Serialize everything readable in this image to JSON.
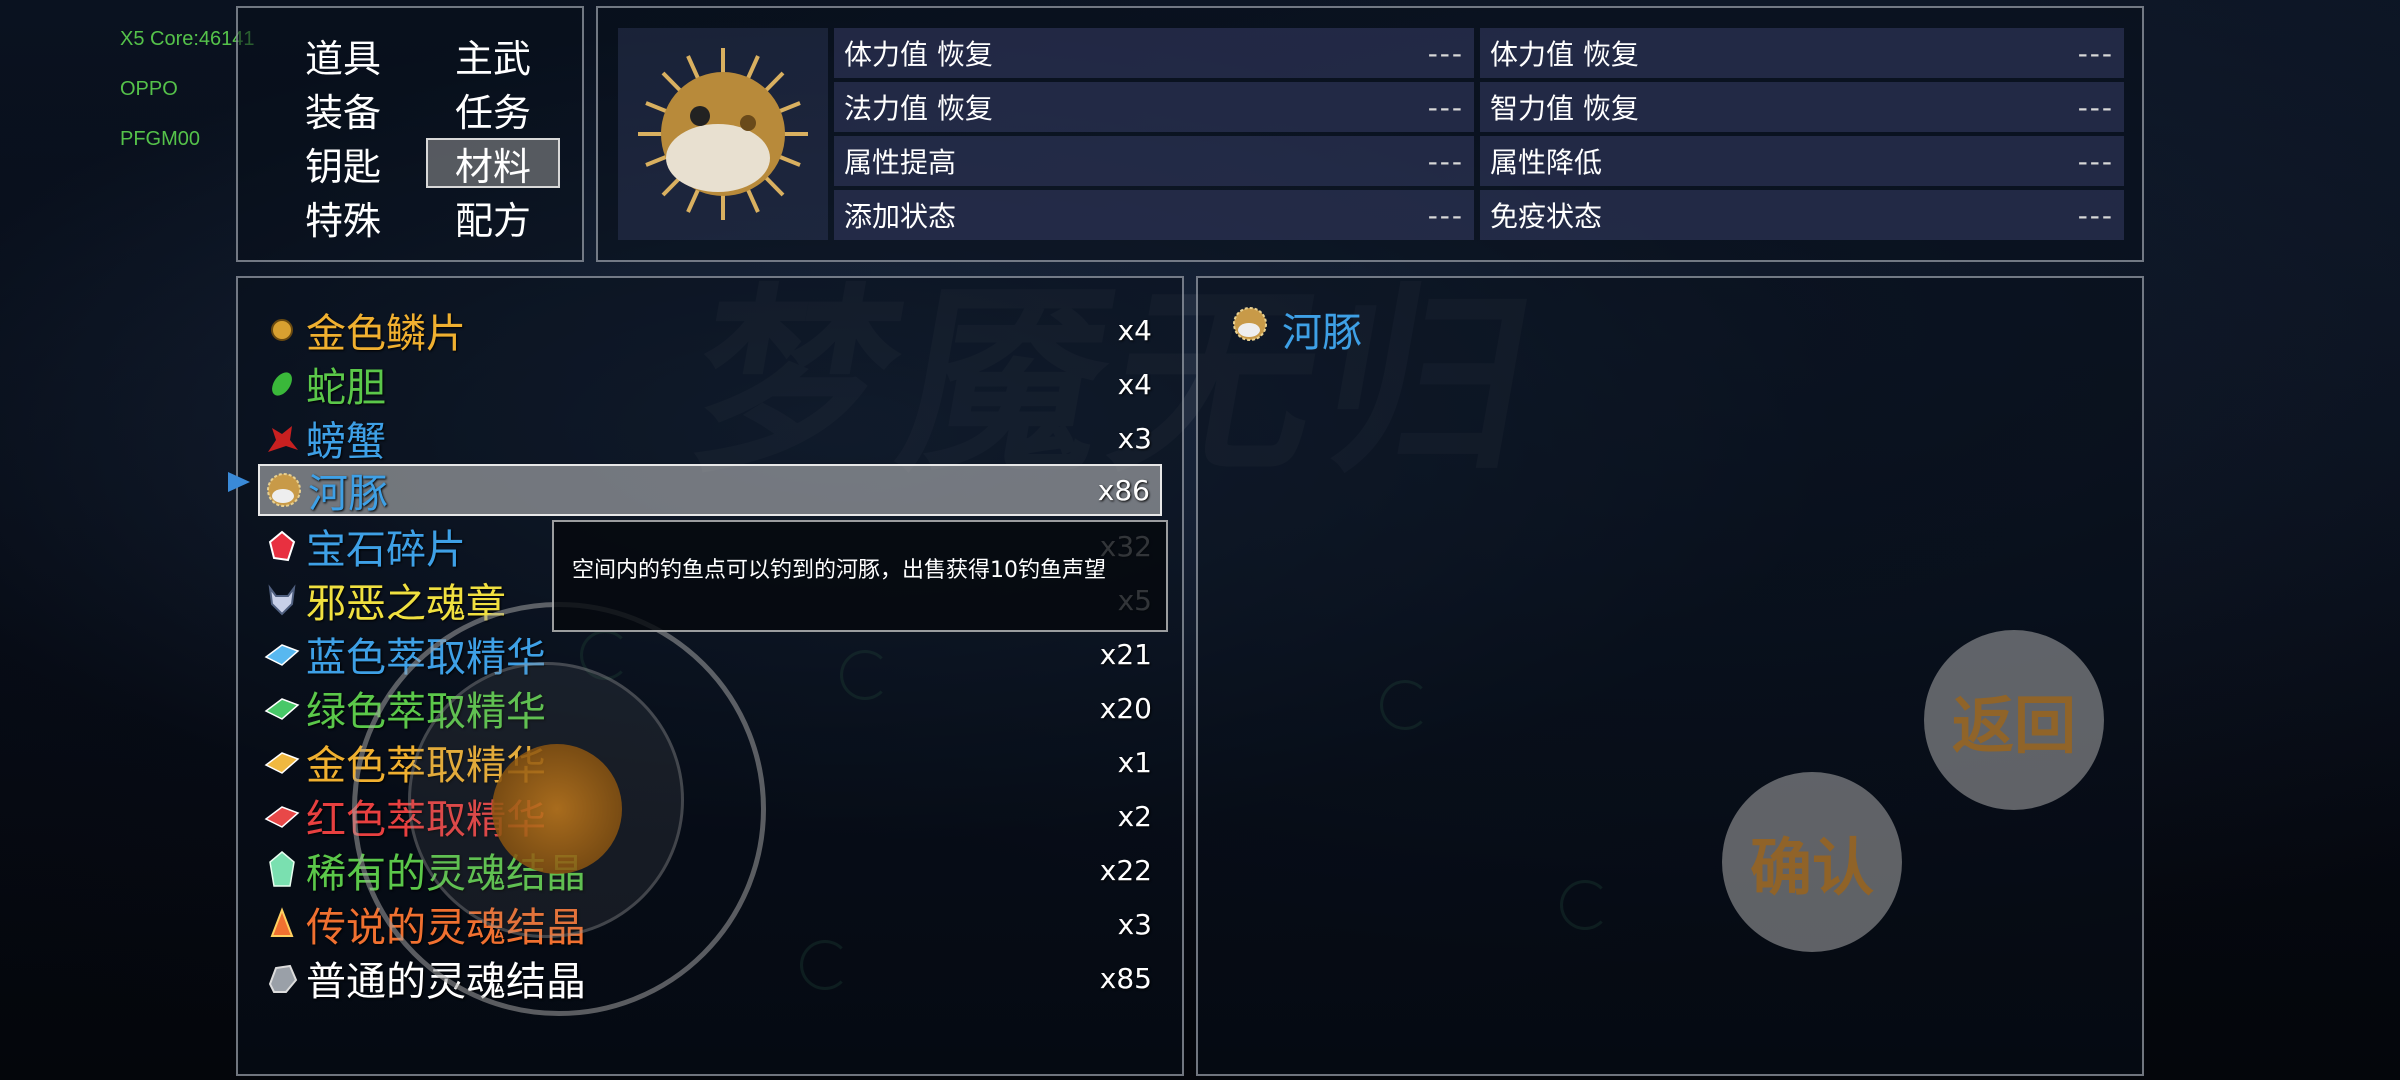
{
  "debug": {
    "core": "X5 Core:46141",
    "brand": "OPPO",
    "model": "PFGM00"
  },
  "categories": [
    {
      "label": "道具",
      "selected": false
    },
    {
      "label": "主武",
      "selected": false
    },
    {
      "label": "装备",
      "selected": false
    },
    {
      "label": "任务",
      "selected": false
    },
    {
      "label": "钥匙",
      "selected": false
    },
    {
      "label": "材料",
      "selected": true
    },
    {
      "label": "特殊",
      "selected": false
    },
    {
      "label": "配方",
      "selected": false
    }
  ],
  "effects": [
    {
      "label": "体力值 恢复",
      "value": "---"
    },
    {
      "label": "体力值 恢复",
      "value": "---"
    },
    {
      "label": "法力值 恢复",
      "value": "---"
    },
    {
      "label": "智力值 恢复",
      "value": "---"
    },
    {
      "label": "属性提高",
      "value": "---"
    },
    {
      "label": "属性降低",
      "value": "---"
    },
    {
      "label": "添加状态",
      "value": "---"
    },
    {
      "label": "免疫状态",
      "value": "---"
    }
  ],
  "items": [
    {
      "name": "金色鳞片",
      "count": "x4",
      "color": "#f0b030",
      "icon": "gold-scale-icon"
    },
    {
      "name": "蛇胆",
      "count": "x4",
      "color": "#5bc84a",
      "icon": "snake-gall-icon"
    },
    {
      "name": "螃蟹",
      "count": "x3",
      "color": "#3ea0e6",
      "icon": "crab-icon"
    },
    {
      "name": "河豚",
      "count": "x86",
      "color": "#3ea0e6",
      "icon": "pufferfish-icon"
    },
    {
      "name": "宝石碎片",
      "count": "x32",
      "color": "#3ea0e6",
      "icon": "gem-shard-icon"
    },
    {
      "name": "邪恶之魂章",
      "count": "x5",
      "color": "#f0e040",
      "icon": "evil-soul-badge-icon"
    },
    {
      "name": "蓝色萃取精华",
      "count": "x21",
      "color": "#3ea0e6",
      "icon": "blue-essence-icon"
    },
    {
      "name": "绿色萃取精华",
      "count": "x20",
      "color": "#5bc84a",
      "icon": "green-essence-icon"
    },
    {
      "name": "金色萃取精华",
      "count": "x1",
      "color": "#f0b030",
      "icon": "gold-essence-icon"
    },
    {
      "name": "红色萃取精华",
      "count": "x2",
      "color": "#e84040",
      "icon": "red-essence-icon"
    },
    {
      "name": "稀有的灵魂结晶",
      "count": "x22",
      "color": "#5bc84a",
      "icon": "rare-soul-crystal-icon"
    },
    {
      "name": "传说的灵魂结晶",
      "count": "x3",
      "color": "#f07030",
      "icon": "legend-soul-crystal-icon"
    },
    {
      "name": "普通的灵魂结晶",
      "count": "x85",
      "color": "#ffffff",
      "icon": "common-soul-crystal-icon"
    }
  ],
  "selected_index": 3,
  "tooltip": "空间内的钓鱼点可以钓到的河豚，出售获得10钓鱼声望",
  "detail": {
    "name": "河豚"
  },
  "buttons": {
    "back": "返回",
    "confirm": "确认"
  }
}
